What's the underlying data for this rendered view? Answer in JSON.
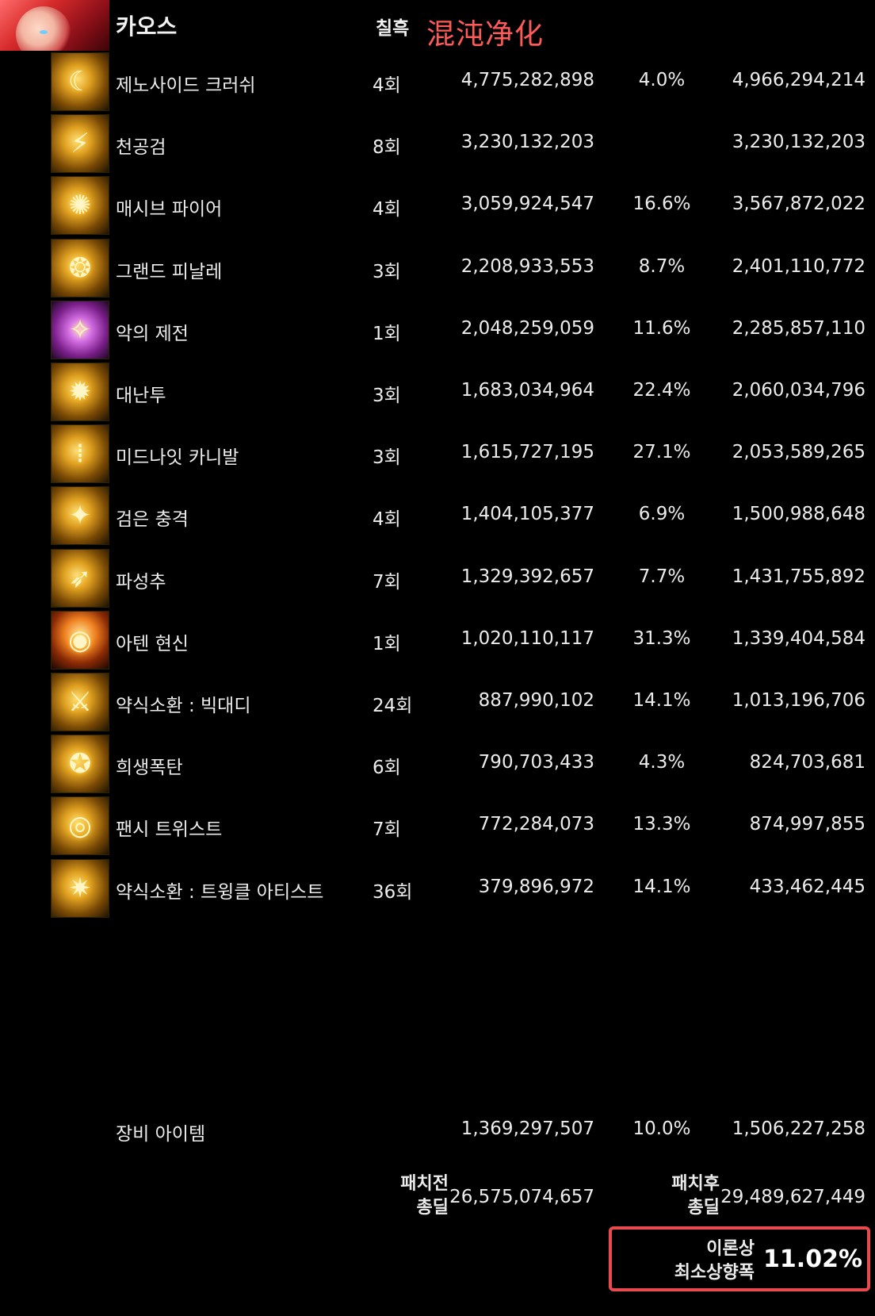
{
  "header": {
    "title": "카오스",
    "column_label": "칠흑",
    "overlay_label": "混沌净化"
  },
  "skills": [
    {
      "name": "제노사이드 크러쉬",
      "count": "4회",
      "before": "4,775,282,898",
      "pct": "4.0%",
      "after": "4,966,294,214",
      "icon": "crescent-icon"
    },
    {
      "name": "천공검",
      "count": "8회",
      "before": "3,230,132,203",
      "pct": "",
      "after": "3,230,132,203",
      "icon": "sword-rain-icon"
    },
    {
      "name": "매시브 파이어",
      "count": "4회",
      "before": "3,059,924,547",
      "pct": "16.6%",
      "after": "3,567,872,022",
      "icon": "cannon-fire-icon"
    },
    {
      "name": "그랜드 피날레",
      "count": "3회",
      "before": "2,208,933,553",
      "pct": "8.7%",
      "after": "2,401,110,772",
      "icon": "finale-icon"
    },
    {
      "name": "악의 제전",
      "count": "1회",
      "before": "2,048,259,059",
      "pct": "11.6%",
      "after": "2,285,857,110",
      "icon": "ritual-icon"
    },
    {
      "name": "대난투",
      "count": "3회",
      "before": "1,683,034,964",
      "pct": "22.4%",
      "after": "2,060,034,796",
      "icon": "brawl-icon"
    },
    {
      "name": "미드나잇 카니발",
      "count": "3회",
      "before": "1,615,727,195",
      "pct": "27.1%",
      "after": "2,053,589,265",
      "icon": "carnival-icon"
    },
    {
      "name": "검은 충격",
      "count": "4회",
      "before": "1,404,105,377",
      "pct": "6.9%",
      "after": "1,500,988,648",
      "icon": "black-shock-icon"
    },
    {
      "name": "파성추",
      "count": "7회",
      "before": "1,329,392,657",
      "pct": "7.7%",
      "after": "1,431,755,892",
      "icon": "comet-icon"
    },
    {
      "name": "아텐 현신",
      "count": "1회",
      "before": "1,020,110,117",
      "pct": "31.3%",
      "after": "1,339,404,584",
      "icon": "aten-icon"
    },
    {
      "name": "약식소환 : 빅대디",
      "count": "24회",
      "before": "887,990,102",
      "pct": "14.1%",
      "after": "1,013,196,706",
      "icon": "big-daddy-icon"
    },
    {
      "name": "희생폭탄",
      "count": "6회",
      "before": "790,703,433",
      "pct": "4.3%",
      "after": "824,703,681",
      "icon": "bomb-icon"
    },
    {
      "name": "팬시 트위스트",
      "count": "7회",
      "before": "772,284,073",
      "pct": "13.3%",
      "after": "874,997,855",
      "icon": "twist-icon"
    },
    {
      "name": "약식소환 : 트윙클 아티스트",
      "count": "36회",
      "before": "379,896,972",
      "pct": "14.1%",
      "after": "433,462,445",
      "icon": "twinkle-artist-icon"
    }
  ],
  "equipment": {
    "name": "장비 아이템",
    "before": "1,369,297,507",
    "pct": "10.0%",
    "after": "1,506,227,258"
  },
  "totals": {
    "before_label_1": "패치전",
    "before_label_2": "총딜",
    "before_value": "26,575,074,657",
    "after_label_1": "패치후",
    "after_label_2": "총딜",
    "after_value": "29,489,627,449"
  },
  "result": {
    "label_1": "이론상",
    "label_2": "최소상향폭",
    "value": "11.02%",
    "accent_color": "#e84a50"
  }
}
